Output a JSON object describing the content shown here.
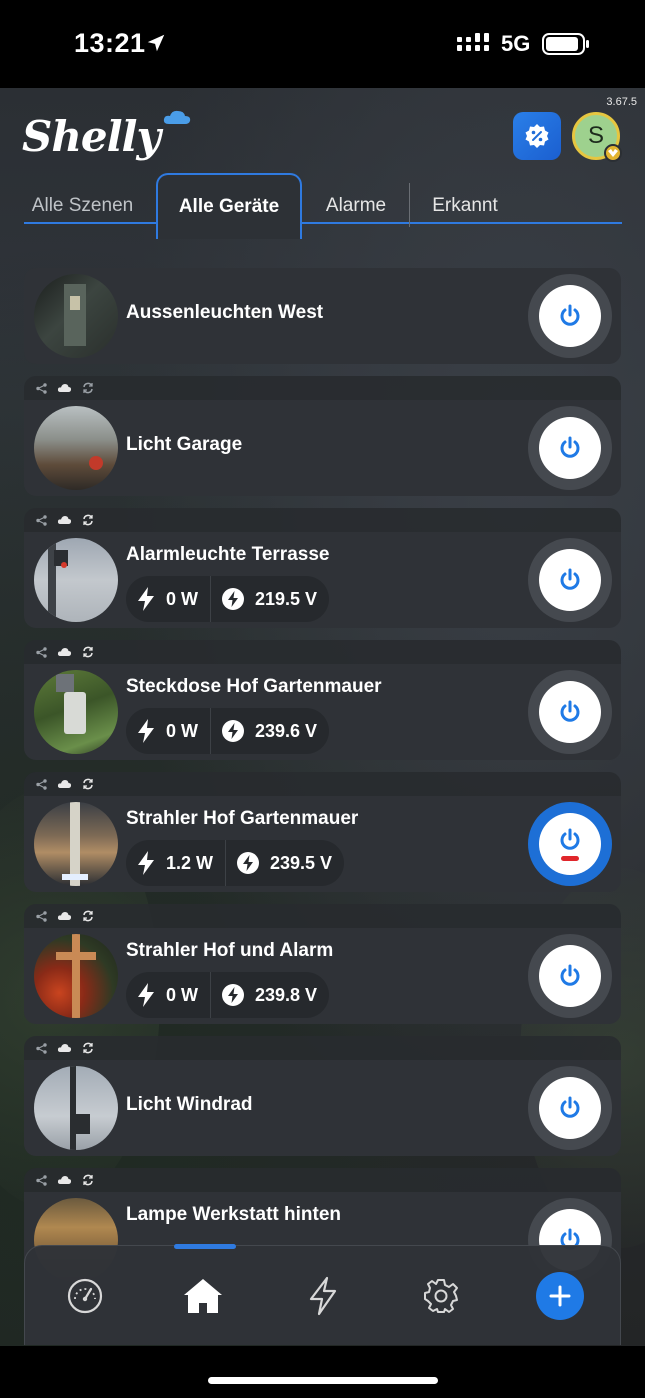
{
  "status_bar": {
    "time": "13:21",
    "network": "5G"
  },
  "header": {
    "app_version": "3.67.5",
    "logo_text": "Shelly",
    "avatar_letter": "S"
  },
  "tabs": [
    {
      "label": "Alle Szenen",
      "active": false
    },
    {
      "label": "Alle Geräte",
      "active": true
    },
    {
      "label": "Alarme",
      "active": false
    },
    {
      "label": "Erkannt",
      "active": false
    }
  ],
  "devices": [
    {
      "name": "Aussenleuchten West",
      "on": false
    },
    {
      "name": "Licht Garage",
      "on": false
    },
    {
      "name": "Alarmleuchte Terrasse",
      "power": "0 W",
      "voltage": "219.5 V",
      "on": false
    },
    {
      "name": "Steckdose Hof Gartenmauer",
      "power": "0 W",
      "voltage": "239.6 V",
      "on": false
    },
    {
      "name": "Strahler Hof Gartenmauer",
      "power": "1.2 W",
      "voltage": "239.5 V",
      "on": true
    },
    {
      "name": "Strahler Hof und Alarm",
      "power": "0 W",
      "voltage": "239.8 V",
      "on": false
    },
    {
      "name": "Licht Windrad",
      "on": false
    },
    {
      "name": "Lampe Werkstatt hinten",
      "on": false
    }
  ],
  "bottom_nav": [
    {
      "icon": "dashboard-gauge-icon",
      "active": false
    },
    {
      "icon": "home-icon",
      "active": true
    },
    {
      "icon": "energy-bolt-icon",
      "active": false
    },
    {
      "icon": "settings-gear-icon",
      "active": false
    },
    {
      "icon": "add-icon",
      "active": false
    }
  ],
  "colors": {
    "accent": "#2f7ae0",
    "card": "#2f3237",
    "on_ring": "#1d6fd6",
    "on_indicator": "#e0262b"
  }
}
